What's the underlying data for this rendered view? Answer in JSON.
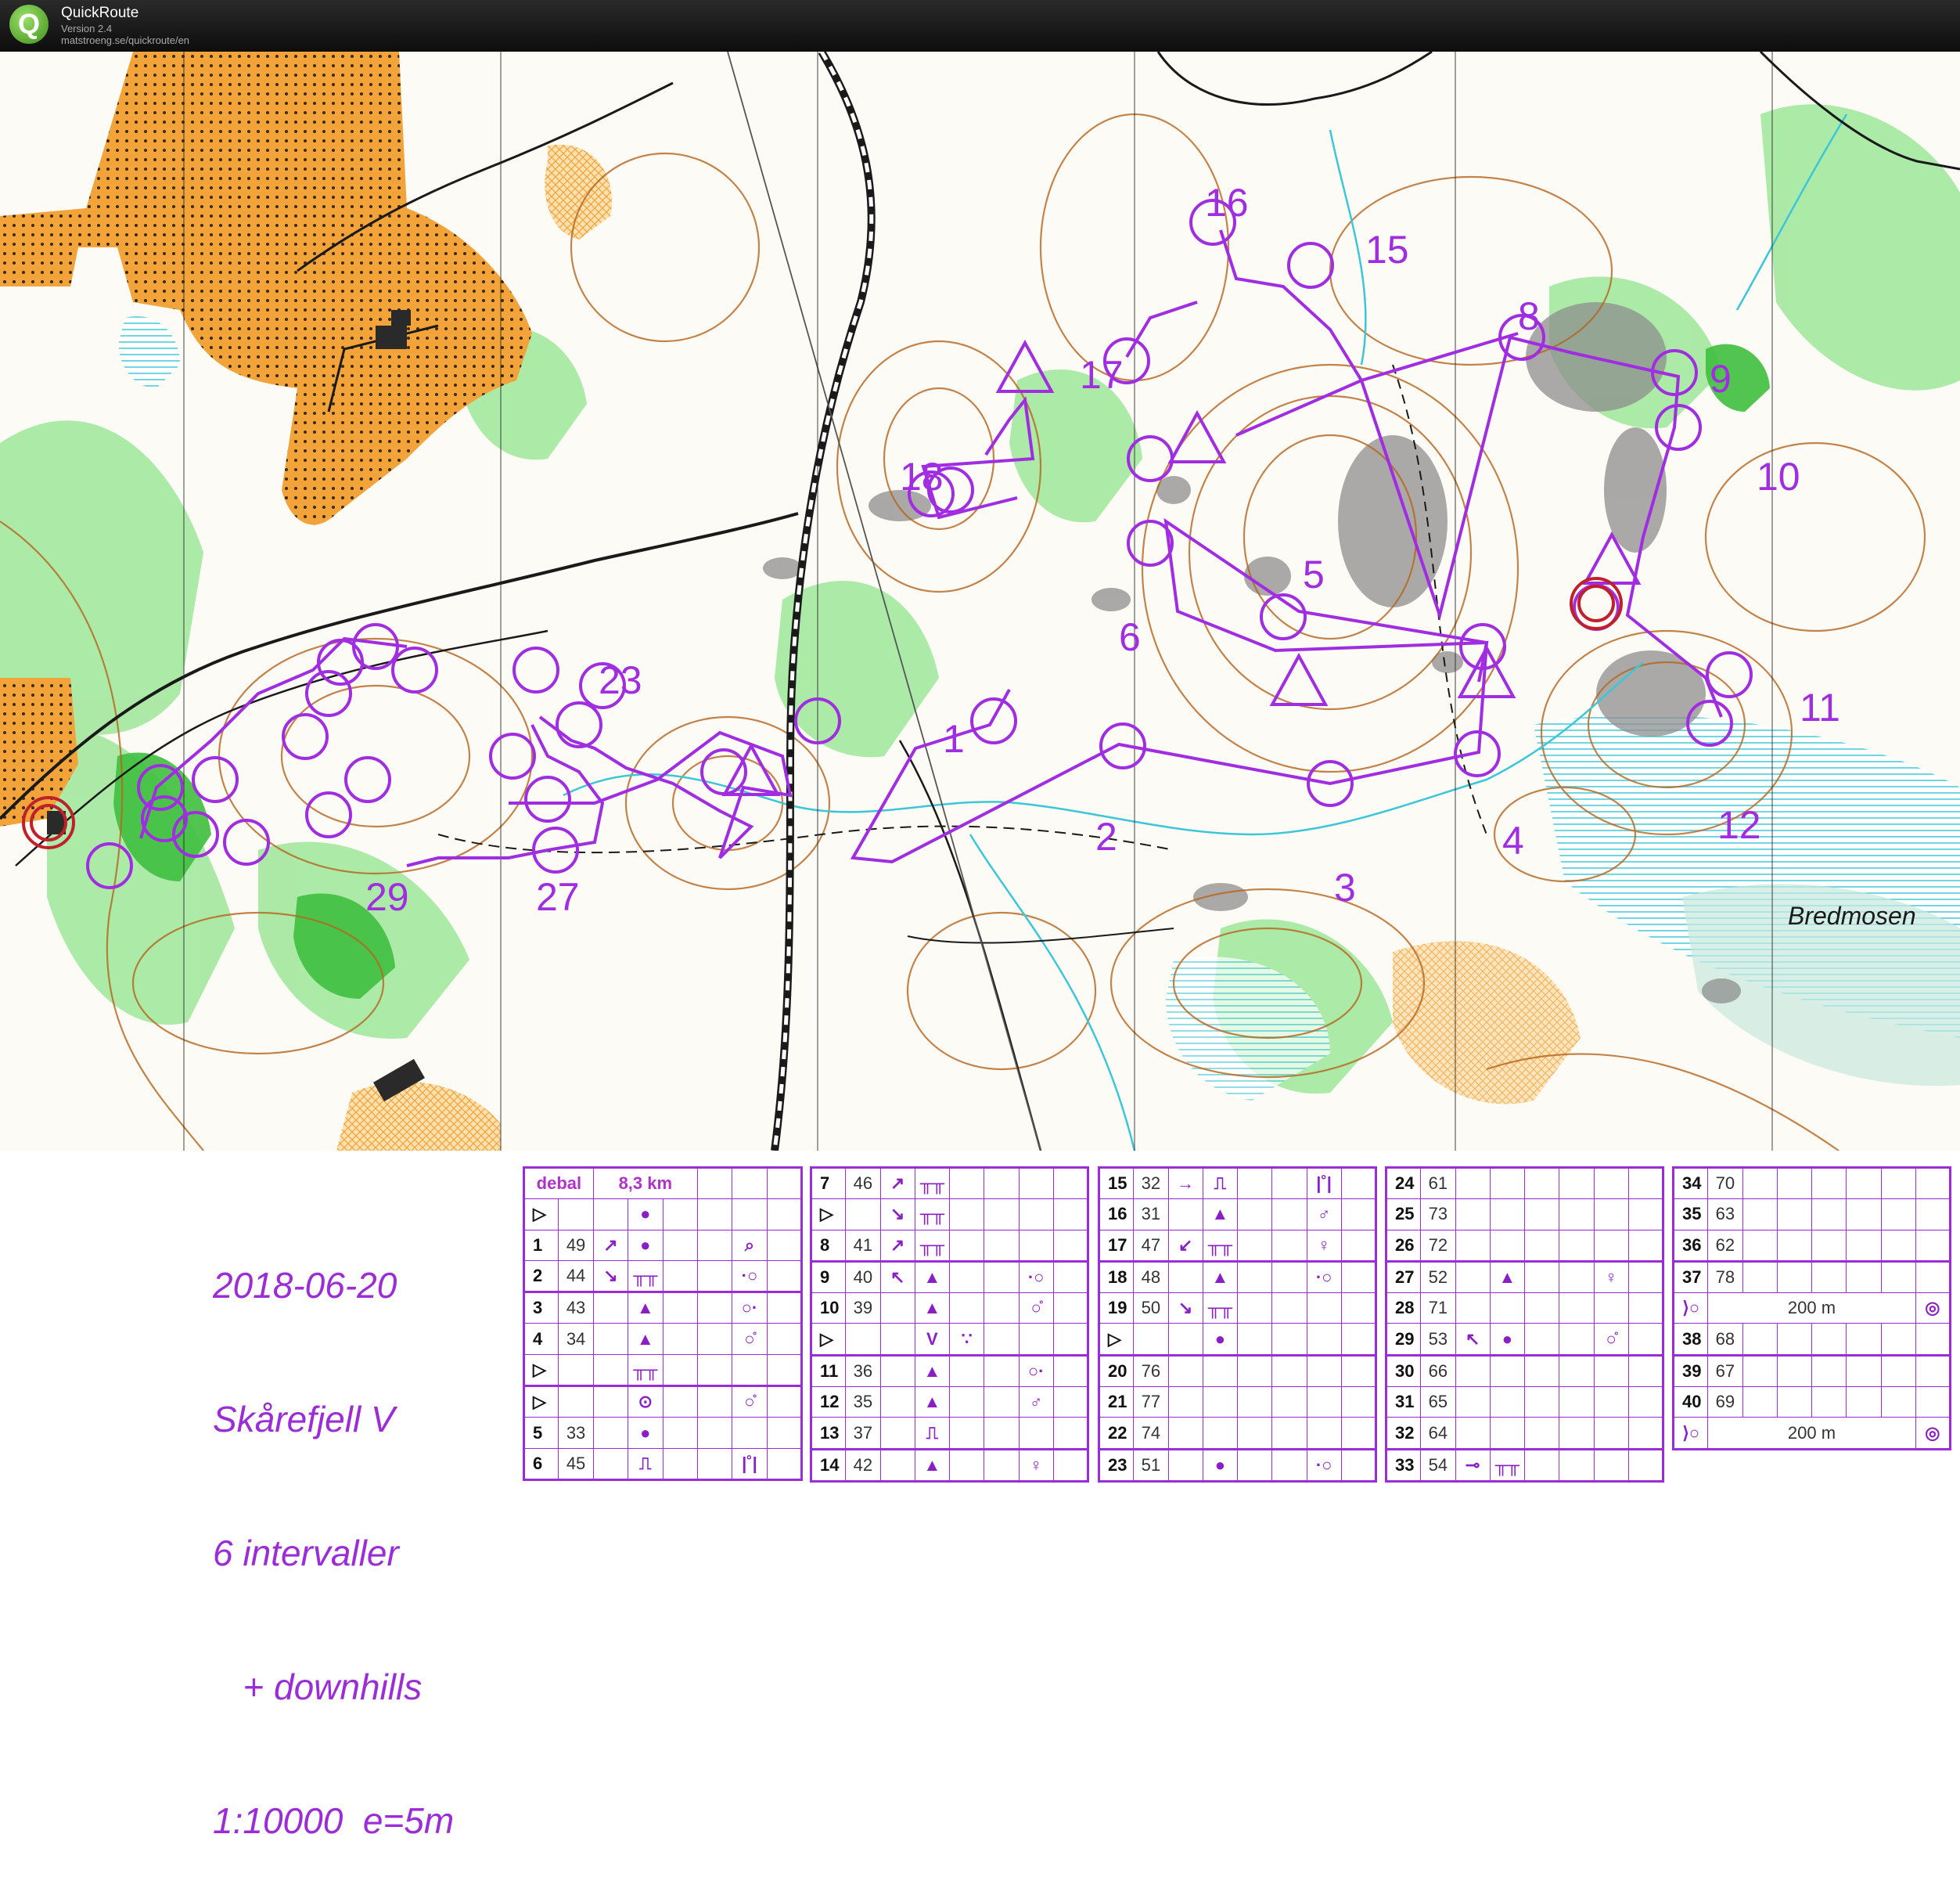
{
  "app": {
    "name": "QuickRoute",
    "version": "Version 2.4",
    "url": "matstroeng.se/quickroute/en",
    "logo_letter": "Q"
  },
  "map": {
    "place_label": "Bredmosen",
    "controls": [
      {
        "n": "1"
      },
      {
        "n": "2"
      },
      {
        "n": "3"
      },
      {
        "n": "4"
      },
      {
        "n": "5"
      },
      {
        "n": "6"
      },
      {
        "n": "8"
      },
      {
        "n": "9"
      },
      {
        "n": "10"
      },
      {
        "n": "11"
      },
      {
        "n": "12"
      },
      {
        "n": "15"
      },
      {
        "n": "16"
      },
      {
        "n": "17"
      },
      {
        "n": "18"
      },
      {
        "n": "23"
      },
      {
        "n": "27"
      },
      {
        "n": "29"
      }
    ],
    "course_color": "#a02ee0",
    "colors": {
      "open": "#f2a43a",
      "forest_green": "#3fbf3f",
      "contour": "#b5651d",
      "water": "#3cc6d8",
      "rock": "#8d8d8d"
    }
  },
  "legend_lines": [
    "2018-06-20",
    "Skårefjell V",
    "6 intervaller",
    "   + downhills",
    "1:10000  e=5m"
  ],
  "descriptions": {
    "header": {
      "name": "debal",
      "length": "8,3 km"
    },
    "col1": [
      {
        "num": "▷",
        "code": "",
        "c": "",
        "d": "●",
        "e": "",
        "g": ""
      },
      {
        "num": "1",
        "code": "49",
        "c": "↗",
        "d": "●",
        "e": "",
        "g": "⌕"
      },
      {
        "num": "2",
        "code": "44",
        "c": "↘",
        "d": "╥╥",
        "e": "",
        "g": "·○"
      },
      {
        "num": "3",
        "code": "43",
        "c": "",
        "d": "▲",
        "e": "",
        "g": "○·"
      },
      {
        "num": "4",
        "code": "34",
        "c": "",
        "d": "▲",
        "e": "",
        "g": "○̊"
      },
      {
        "num": "▷",
        "code": "",
        "c": "",
        "d": "╥╥",
        "e": "",
        "g": ""
      },
      {
        "num": "▷",
        "code": "",
        "c": "",
        "d": "⊙",
        "e": "",
        "g": "○̊"
      },
      {
        "num": "5",
        "code": "33",
        "c": "",
        "d": "●",
        "e": "",
        "g": ""
      },
      {
        "num": "6",
        "code": "45",
        "c": "",
        "d": "⎍",
        "e": "",
        "g": "|˚|"
      }
    ],
    "col2": [
      {
        "num": "7",
        "code": "46",
        "c": "↗",
        "d": "╥╥",
        "g": ""
      },
      {
        "num": "▷",
        "code": "",
        "c": "↘",
        "d": "╥╥",
        "g": ""
      },
      {
        "num": "8",
        "code": "41",
        "c": "↗",
        "d": "╥╥",
        "g": ""
      },
      {
        "num": "9",
        "code": "40",
        "c": "↖",
        "d": "▲",
        "g": "·○"
      },
      {
        "num": "10",
        "code": "39",
        "c": "",
        "d": "▲",
        "g": "○̊"
      },
      {
        "num": "▷",
        "code": "",
        "c": "",
        "d": "V",
        "e": "∵",
        "g": ""
      },
      {
        "num": "11",
        "code": "36",
        "c": "",
        "d": "▲",
        "g": "○·"
      },
      {
        "num": "12",
        "code": "35",
        "c": "",
        "d": "▲",
        "g": "♂"
      },
      {
        "num": "13",
        "code": "37",
        "c": "",
        "d": "⎍",
        "g": ""
      },
      {
        "num": "14",
        "code": "42",
        "c": "",
        "d": "▲",
        "g": "♀"
      }
    ],
    "col3": [
      {
        "num": "15",
        "code": "32",
        "c": "→",
        "d": "⎍",
        "g": "|˚|"
      },
      {
        "num": "16",
        "code": "31",
        "c": "",
        "d": "▲",
        "g": "♂"
      },
      {
        "num": "17",
        "code": "47",
        "c": "↙",
        "d": "╥╥",
        "g": "♀"
      },
      {
        "num": "18",
        "code": "48",
        "c": "",
        "d": "▲",
        "g": "·○"
      },
      {
        "num": "19",
        "code": "50",
        "c": "↘",
        "d": "╥╥",
        "g": ""
      },
      {
        "num": "▷",
        "code": "",
        "c": "",
        "d": "●",
        "g": ""
      },
      {
        "num": "20",
        "code": "76",
        "c": "",
        "d": "",
        "g": ""
      },
      {
        "num": "21",
        "code": "77",
        "c": "",
        "d": "",
        "g": ""
      },
      {
        "num": "22",
        "code": "74",
        "c": "",
        "d": "",
        "g": ""
      },
      {
        "num": "23",
        "code": "51",
        "c": "",
        "d": "●",
        "g": "·○"
      }
    ],
    "col4": [
      {
        "num": "24",
        "code": "61",
        "c": "",
        "d": "",
        "g": ""
      },
      {
        "num": "25",
        "code": "73",
        "c": "",
        "d": "",
        "g": ""
      },
      {
        "num": "26",
        "code": "72",
        "c": "",
        "d": "",
        "g": ""
      },
      {
        "num": "27",
        "code": "52",
        "c": "",
        "d": "▲",
        "g": "♀"
      },
      {
        "num": "28",
        "code": "71",
        "c": "",
        "d": "",
        "g": ""
      },
      {
        "num": "29",
        "code": "53",
        "c": "↖",
        "d": "●",
        "g": "○̊"
      },
      {
        "num": "30",
        "code": "66",
        "c": "",
        "d": "",
        "g": ""
      },
      {
        "num": "31",
        "code": "65",
        "c": "",
        "d": "",
        "g": ""
      },
      {
        "num": "32",
        "code": "64",
        "c": "",
        "d": "",
        "g": ""
      },
      {
        "num": "33",
        "code": "54",
        "c": "⊸",
        "d": "╥╥",
        "g": ""
      }
    ],
    "col5": [
      {
        "num": "34",
        "code": "70"
      },
      {
        "num": "35",
        "code": "63"
      },
      {
        "num": "36",
        "code": "62"
      },
      {
        "num": "37",
        "code": "78"
      },
      {
        "finish": true,
        "text": "200 m"
      },
      {
        "num": "38",
        "code": "68"
      },
      {
        "num": "39",
        "code": "67"
      },
      {
        "num": "40",
        "code": "69"
      },
      {
        "finish": true,
        "text": "200 m"
      }
    ]
  }
}
